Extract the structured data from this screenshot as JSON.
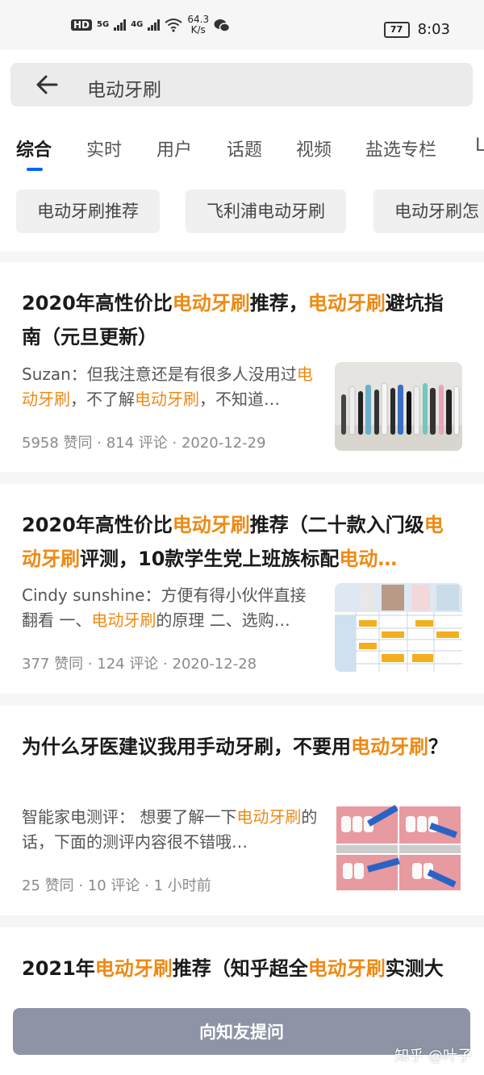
{
  "status_bar": {
    "hd": "HD",
    "net1": "5G",
    "net2": "4G",
    "speed_value": "64.3",
    "speed_unit": "K/s",
    "battery": "77",
    "time": "8:03"
  },
  "search": {
    "query": "电动牙刷"
  },
  "tabs": [
    "综合",
    "实时",
    "用户",
    "话题",
    "视频",
    "盐选专栏",
    "L"
  ],
  "chips": [
    "电动牙刷推荐",
    "飞利浦电动牙刷",
    "电动牙刷怎"
  ],
  "colors": {
    "highlight": "#ee8a13",
    "accent": "#0066ff",
    "button": "#8e94a5"
  },
  "results": [
    {
      "title_parts": [
        "2020年高性价比",
        "电动牙刷",
        "推荐，",
        "电动牙刷",
        "避坑指南（元旦更新）"
      ],
      "excerpt_parts": [
        "Suzan：但我注意还是有很多人没用过",
        "电动牙刷",
        "，不了解",
        "电动牙刷",
        "，不知道…"
      ],
      "meta": "5958 赞同 · 814 评论 · 2020-12-29",
      "thumb": "toothbrush-lineup-photo"
    },
    {
      "title_parts": [
        "2020年高性价比",
        "电动牙刷",
        "推荐（二十款入门级",
        "电动牙刷",
        "评测，10款学生党上班族标配",
        "电动…"
      ],
      "excerpt_parts": [
        "Cindy sunshine：方便有得小伙伴直接翻看 一、",
        "电动牙刷",
        "的原理 二、选购…"
      ],
      "meta": "377 赞同 · 124 评论 · 2020-12-28",
      "thumb": "comparison-table-image"
    },
    {
      "title_parts": [
        "为什么牙医建议我用手动牙刷，不要用",
        "电动牙刷",
        "？"
      ],
      "excerpt_parts": [
        "智能家电测评： 想要了解一下",
        "电动牙刷",
        "的话，下面的测评内容很不错哦…"
      ],
      "meta": "25 赞同 · 10 评论 · 1 小时前",
      "thumb": "brushing-diagram-image"
    },
    {
      "title_parts": [
        "2021年",
        "电动牙刷",
        "推荐（知乎超全",
        "电动牙刷",
        "实测大比拼，建议收藏）（元旦版）"
      ]
    }
  ],
  "ask_button": "向知友提问",
  "watermark": "知乎 @叶子"
}
